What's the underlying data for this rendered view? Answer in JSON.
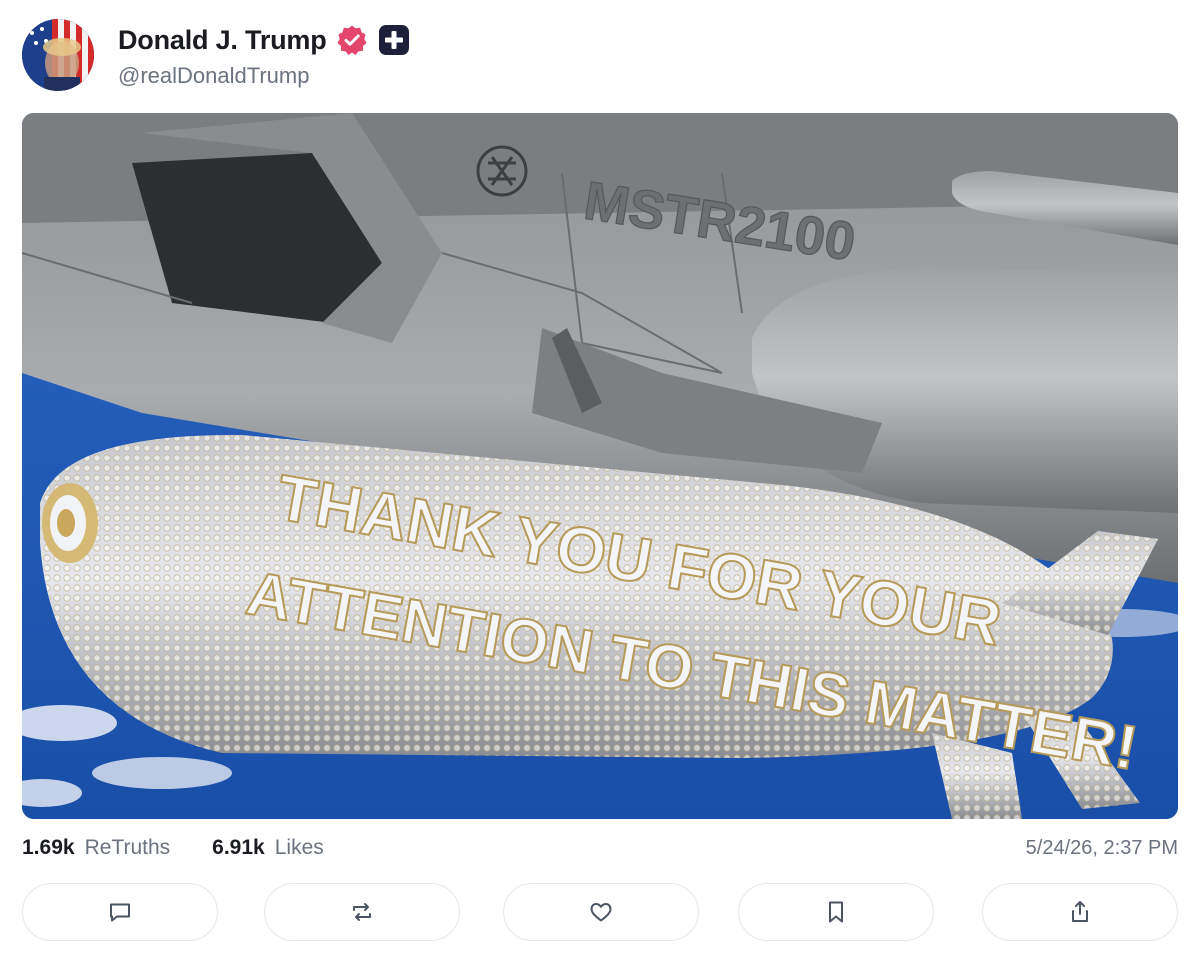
{
  "post": {
    "author": {
      "display_name": "Donald J. Trump",
      "handle": "@realDonaldTrump",
      "verified": true
    },
    "media": {
      "photo_texts": [
        "MSTR2100",
        "THANK YOU FOR YOUR",
        "ATTENTION TO THIS MATTER!"
      ],
      "sky_color": "#1f59b8"
    },
    "stats": {
      "retruths_count": "1.69k",
      "retruths_label": "ReTruths",
      "likes_count": "6.91k",
      "likes_label": "Likes"
    },
    "timestamp": "5/24/26, 2:37 PM",
    "actions": [
      {
        "icon": "reply-icon"
      },
      {
        "icon": "retruth-icon"
      },
      {
        "icon": "like-icon"
      },
      {
        "icon": "bookmark-icon"
      },
      {
        "icon": "share-icon"
      }
    ]
  },
  "colors": {
    "verified_badge": "#e4456b",
    "plus_badge": "#1e1f3a",
    "muted_text": "#6b7280",
    "border": "#e5e7eb"
  }
}
